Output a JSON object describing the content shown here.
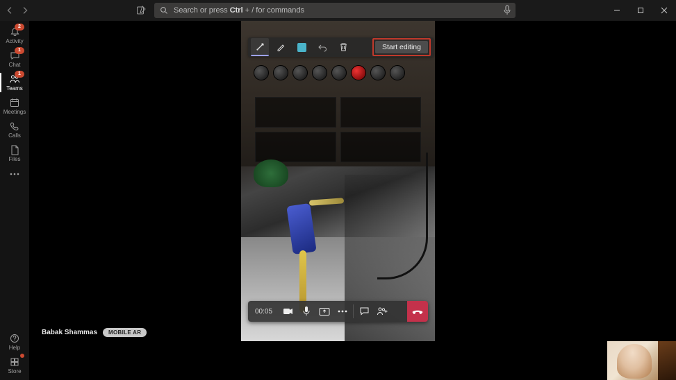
{
  "search": {
    "prefix": "Search or press ",
    "hotkey": "Ctrl",
    "suffix": " + / for commands"
  },
  "sidebar": {
    "items": [
      {
        "id": "activity",
        "label": "Activity",
        "badge": "2"
      },
      {
        "id": "chat",
        "label": "Chat",
        "badge": "1"
      },
      {
        "id": "teams",
        "label": "Teams",
        "badge": "1"
      },
      {
        "id": "meetings",
        "label": "Meetings"
      },
      {
        "id": "calls",
        "label": "Calls"
      },
      {
        "id": "files",
        "label": "Files"
      }
    ],
    "help": {
      "label": "Help"
    },
    "store": {
      "label": "Store",
      "badge_dot": true
    }
  },
  "annotation_toolbar": {
    "start_editing_label": "Start editing"
  },
  "call_controls": {
    "timer": "00:05"
  },
  "caller": {
    "name": "Babak Shammas",
    "badge": "MOBILE AR"
  }
}
